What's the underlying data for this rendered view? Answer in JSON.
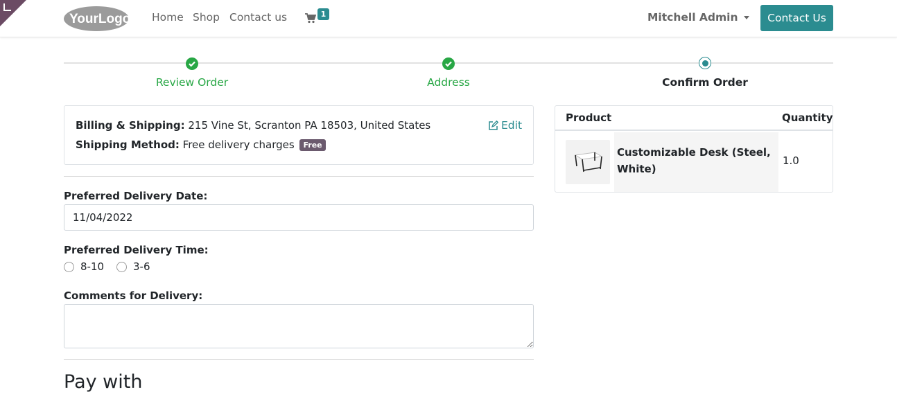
{
  "header": {
    "logo_text": "YourLogo",
    "nav": {
      "home": "Home",
      "shop": "Shop",
      "contact": "Contact us"
    },
    "cart_count": "1",
    "user_name": "Mitchell Admin",
    "contact_button": "Contact Us",
    "accent_color": "#2b8c90"
  },
  "wizard": {
    "steps": [
      {
        "label": "Review Order",
        "state": "done"
      },
      {
        "label": "Address",
        "state": "done"
      },
      {
        "label": "Confirm Order",
        "state": "current"
      }
    ]
  },
  "address": {
    "billing_label": "Billing & Shipping:",
    "billing_value": "215 Vine St, Scranton PA 18503, United States",
    "shipping_label": "Shipping Method:",
    "shipping_value": "Free delivery charges",
    "shipping_badge": "Free",
    "edit_label": "Edit"
  },
  "delivery": {
    "date_label": "Preferred Delivery Date:",
    "date_value": "11/04/2022",
    "time_label": "Preferred Delivery Time:",
    "time_options": [
      "8-10",
      "3-6"
    ],
    "comments_label": "Comments for Delivery:",
    "comments_value": ""
  },
  "payment": {
    "title": "Pay with"
  },
  "summary": {
    "columns": [
      "Product",
      "Quantity"
    ],
    "rows": [
      {
        "product": "Customizable Desk (Steel, White)",
        "quantity": "1.0",
        "icon": "desk-thumbnail"
      }
    ]
  }
}
